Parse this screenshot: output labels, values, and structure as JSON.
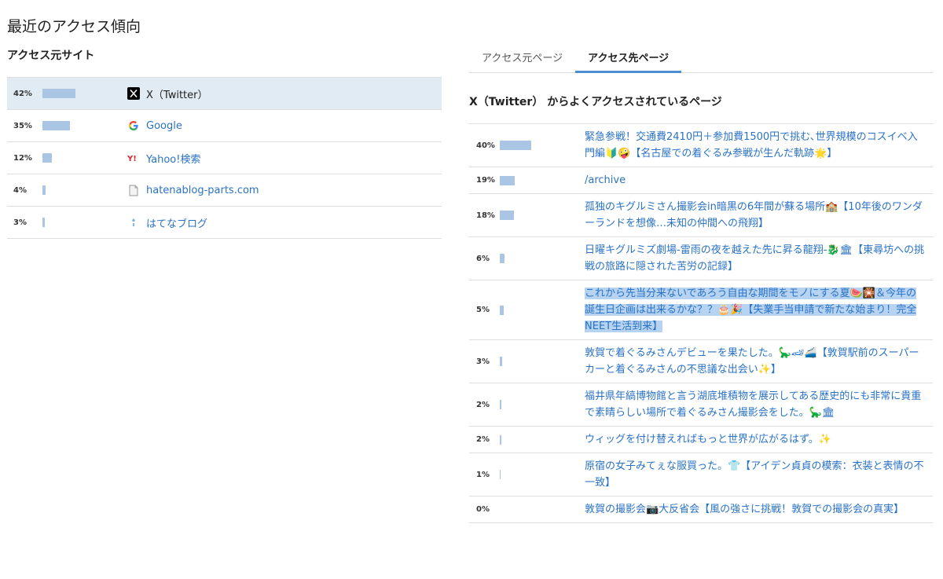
{
  "page_title": "最近のアクセス傾向",
  "left": {
    "title": "アクセス元サイト",
    "sources": [
      {
        "pct": "42%",
        "value": 42,
        "icon": "x-logo-icon",
        "label": "X（Twitter）",
        "selected": true
      },
      {
        "pct": "35%",
        "value": 35,
        "icon": "google-logo-icon",
        "label": "Google",
        "selected": false
      },
      {
        "pct": "12%",
        "value": 12,
        "icon": "yahoo-logo-icon",
        "label": "Yahoo!検索",
        "selected": false
      },
      {
        "pct": "4%",
        "value": 4,
        "icon": "document-icon",
        "label": "hatenablog-parts.com",
        "selected": false
      },
      {
        "pct": "3%",
        "value": 3,
        "icon": "hatena-blog-icon",
        "label": "はてなブログ",
        "selected": false
      }
    ]
  },
  "right": {
    "tabs": [
      {
        "label": "アクセス元ページ",
        "active": false
      },
      {
        "label": "アクセス先ページ",
        "active": true
      }
    ],
    "title": "X（Twitter） からよくアクセスされているページ",
    "pages": [
      {
        "pct": "40%",
        "value": 40,
        "title": "緊急参戦！交通費2410円＋参加費1500円で挑む､世界規模のコスイベ入門編🔰🤪【名古屋での着ぐるみ参戦が生んだ軌跡🌟】"
      },
      {
        "pct": "19%",
        "value": 19,
        "title": "/archive"
      },
      {
        "pct": "18%",
        "value": 18,
        "title": "孤独のキグルミさん撮影会in暗黒の6年間が蘇る場所🏫【10年後のワンダーランドを想像…未知の仲間への飛翔】"
      },
      {
        "pct": "6%",
        "value": 6,
        "title": "日曜キグルミズ劇場-雷雨の夜を越えた先に昇る龍翔-🐉🏛【東尋坊への挑戦の旅路に隠された苦労の記録】"
      },
      {
        "pct": "5%",
        "value": 5,
        "title": "これから先当分来ないであろう自由な期間をモノにする夏🍉🎇＆今年の誕生日企画は出来るかな？？🎂🎉【失業手当申請で新たな始まり！完全NEET生活到来】",
        "highlighted": true
      },
      {
        "pct": "3%",
        "value": 3,
        "title": "敦賀で着ぐるみさんデビューを果たした。🦕🏎🚄【敦賀駅前のスーパーカーと着ぐるみさんの不思議な出会い✨】"
      },
      {
        "pct": "2%",
        "value": 2,
        "title": "福井県年縞博物館と言う湖底堆積物を展示してある歴史的にも非常に貴重で素晴らしい場所で着ぐるみさん撮影会をした。🦕🏛"
      },
      {
        "pct": "2%",
        "value": 2,
        "title": "ウィッグを付け替えればもっと世界が広がるはず。✨"
      },
      {
        "pct": "1%",
        "value": 1,
        "title": "原宿の女子みてぇな服買った。👕【アイデン貞貞の模索：衣装と表情の不一致】"
      },
      {
        "pct": "0%",
        "value": 0,
        "title": "敦賀の撮影会📷大反省会【風の強さに挑戦！敦賀での撮影会の真実】"
      }
    ]
  }
}
